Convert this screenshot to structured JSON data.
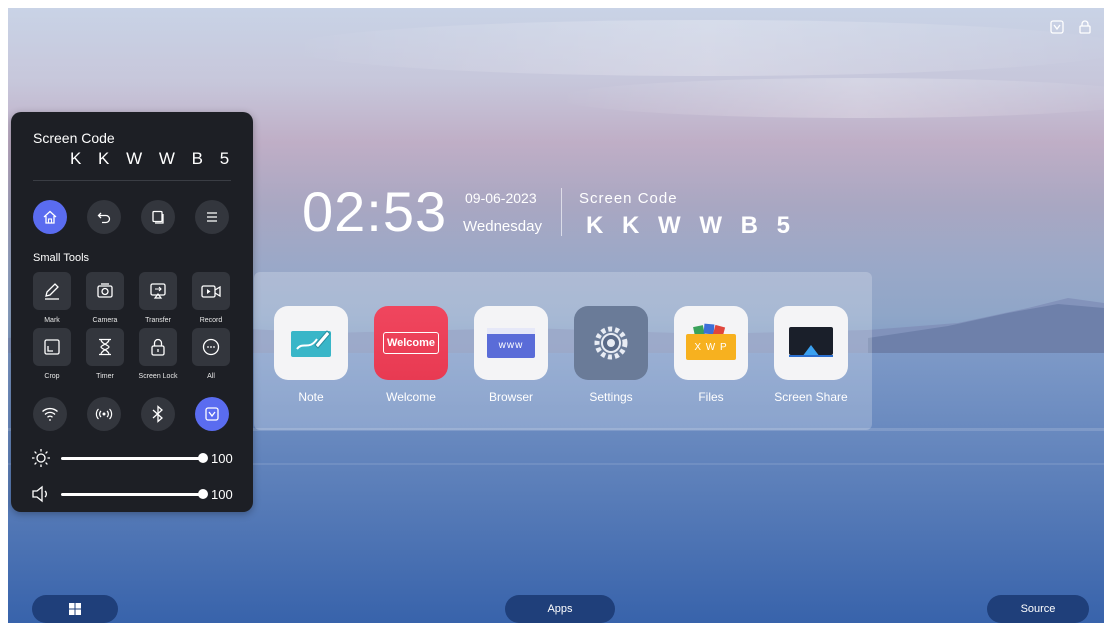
{
  "panel": {
    "screen_code_label": "Screen Code",
    "screen_code": "K K W W B 5",
    "nav_buttons": [
      {
        "name": "home-icon",
        "active": true
      },
      {
        "name": "back-icon",
        "active": false
      },
      {
        "name": "window-icon",
        "active": false
      },
      {
        "name": "menu-icon",
        "active": false
      }
    ],
    "small_tools_title": "Small Tools",
    "tools": [
      {
        "label": "Mark",
        "icon": "pen-icon"
      },
      {
        "label": "Camera",
        "icon": "camera-icon"
      },
      {
        "label": "Transfer",
        "icon": "transfer-icon"
      },
      {
        "label": "Record",
        "icon": "record-icon"
      },
      {
        "label": "Crop",
        "icon": "crop-icon"
      },
      {
        "label": "Timer",
        "icon": "hourglass-icon"
      },
      {
        "label": "Screen Lock",
        "icon": "lock-icon"
      },
      {
        "label": "All",
        "icon": "more-icon"
      }
    ],
    "toggles": [
      {
        "name": "wifi-icon",
        "active": false
      },
      {
        "name": "hotspot-icon",
        "active": false
      },
      {
        "name": "bluetooth-icon",
        "active": false
      },
      {
        "name": "eye-care-icon",
        "active": true
      }
    ],
    "brightness": {
      "icon": "brightness-icon",
      "value": "100",
      "level": 1.0
    },
    "volume": {
      "icon": "volume-icon",
      "value": "100",
      "level": 1.0
    }
  },
  "clock": {
    "time": "02:53",
    "date": "09-06-2023",
    "weekday": "Wednesday",
    "screen_code_label": "Screen Code",
    "screen_code": "K K W W B 5"
  },
  "apps": [
    {
      "label": "Note",
      "icon": "note-icon",
      "inner": ""
    },
    {
      "label": "Welcome",
      "icon": "welcome-icon",
      "inner": "Welcome"
    },
    {
      "label": "Browser",
      "icon": "browser-icon",
      "inner": "www"
    },
    {
      "label": "Settings",
      "icon": "settings-icon",
      "inner": ""
    },
    {
      "label": "Files",
      "icon": "files-icon",
      "inner": "X W P"
    },
    {
      "label": "Screen Share",
      "icon": "screen-share-icon",
      "inner": ""
    }
  ],
  "bottom_bar": {
    "windows_icon": "windows-icon",
    "apps_label": "Apps",
    "source_label": "Source"
  },
  "top_right_icons": [
    "eye-care-small-icon",
    "lock-small-icon"
  ],
  "colors": {
    "accent": "#5a6cf0",
    "panel_bg": "#1d1f25",
    "button_bg": "#33363d",
    "bottom_pill": "#1f3f7a"
  }
}
